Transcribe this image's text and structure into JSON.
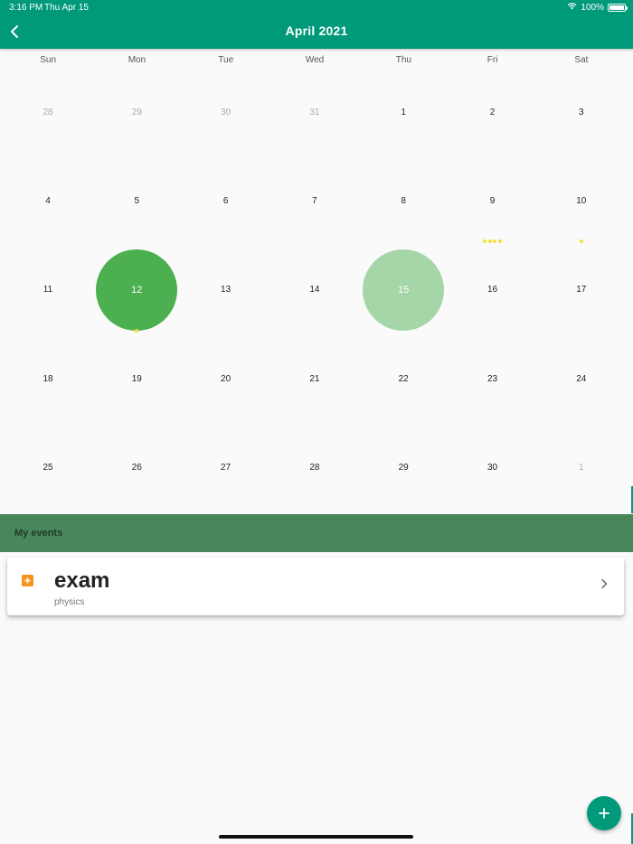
{
  "status_bar": {
    "time": "3:16 PM",
    "date": "Thu Apr 15",
    "battery": "100%"
  },
  "header": {
    "title": "April 2021"
  },
  "calendar": {
    "weekdays": [
      "Sun",
      "Mon",
      "Tue",
      "Wed",
      "Thu",
      "Fri",
      "Sat"
    ],
    "weeks": [
      [
        {
          "n": "28",
          "muted": true
        },
        {
          "n": "29",
          "muted": true
        },
        {
          "n": "30",
          "muted": true
        },
        {
          "n": "31",
          "muted": true
        },
        {
          "n": "1"
        },
        {
          "n": "2"
        },
        {
          "n": "3"
        }
      ],
      [
        {
          "n": "4"
        },
        {
          "n": "5"
        },
        {
          "n": "6"
        },
        {
          "n": "7"
        },
        {
          "n": "8"
        },
        {
          "n": "9",
          "dots": 4
        },
        {
          "n": "10",
          "dots": 1
        }
      ],
      [
        {
          "n": "11"
        },
        {
          "n": "12",
          "state": "selected",
          "dots": 1
        },
        {
          "n": "13"
        },
        {
          "n": "14"
        },
        {
          "n": "15",
          "state": "today"
        },
        {
          "n": "16"
        },
        {
          "n": "17"
        }
      ],
      [
        {
          "n": "18"
        },
        {
          "n": "19"
        },
        {
          "n": "20"
        },
        {
          "n": "21"
        },
        {
          "n": "22"
        },
        {
          "n": "23"
        },
        {
          "n": "24"
        }
      ],
      [
        {
          "n": "25"
        },
        {
          "n": "26"
        },
        {
          "n": "27"
        },
        {
          "n": "28"
        },
        {
          "n": "29"
        },
        {
          "n": "30"
        },
        {
          "n": "1",
          "muted": true
        }
      ]
    ]
  },
  "events_section": {
    "title": "My events",
    "events": [
      {
        "title": "exam",
        "subtitle": "physics"
      }
    ]
  },
  "colors": {
    "primary": "#00997a",
    "selected_day": "#4caf50",
    "today": "#a5d6a7",
    "event_dot": "#f2e23a",
    "events_header": "#47875a",
    "event_icon": "#f7941d"
  }
}
